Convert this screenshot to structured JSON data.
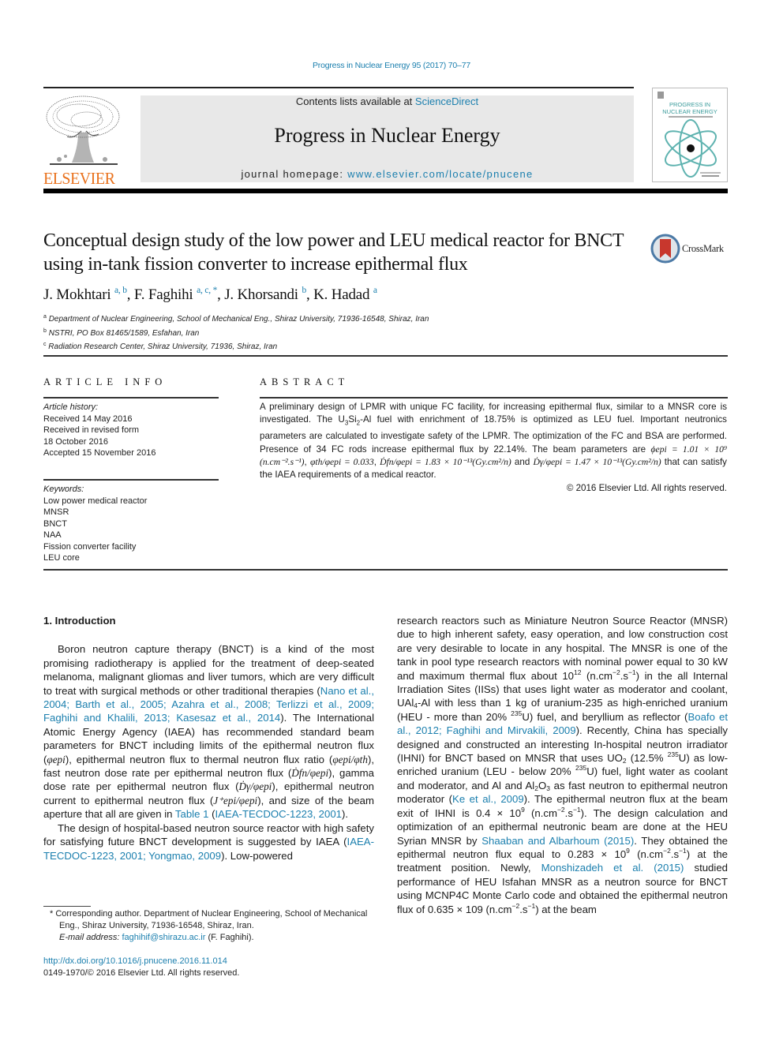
{
  "header": {
    "journal_ref": "Progress in Nuclear Energy 95 (2017) 70–77",
    "contents_prefix": "Contents lists available at ",
    "contents_link": "ScienceDirect",
    "journal_title": "Progress in Nuclear Energy",
    "homepage_prefix": "journal homepage: ",
    "homepage_link": "www.elsevier.com/locate/pnucene",
    "publisher_logo_text": "ELSEVIER",
    "cover_title_line1": "PROGRESS IN",
    "cover_title_line2": "NUCLEAR ENERGY",
    "crossmark_label": "CrossMark",
    "colors": {
      "link": "#1b7fae",
      "elsevier_orange": "#e9711c",
      "cover_teal": "#3a9b9b"
    }
  },
  "article": {
    "title": "Conceptual design study of the low power and LEU medical reactor for BNCT using in-tank fission converter to increase epithermal flux",
    "authors": [
      {
        "name": "J. Mokhtari",
        "sup": "a, b"
      },
      {
        "name": "F. Faghihi",
        "sup": "a, c, *"
      },
      {
        "name": "J. Khorsandi",
        "sup": "b"
      },
      {
        "name": "K. Hadad",
        "sup": "a"
      }
    ],
    "affiliations": [
      {
        "key": "a",
        "text": "Department of Nuclear Engineering, School of Mechanical Eng., Shiraz University, 71936-16548, Shiraz, Iran"
      },
      {
        "key": "b",
        "text": "NSTRI, PO Box 81465/1589, Esfahan, Iran"
      },
      {
        "key": "c",
        "text": "Radiation Research Center, Shiraz University, 71936, Shiraz, Iran"
      }
    ]
  },
  "article_info": {
    "heading": "ARTICLE INFO",
    "history_label": "Article history:",
    "history": [
      "Received 14 May 2016",
      "Received in revised form",
      "18 October 2016",
      "Accepted 15 November 2016"
    ],
    "keywords_label": "Keywords:",
    "keywords": [
      "Low power medical reactor",
      "MNSR",
      "BNCT",
      "NAA",
      "Fission converter facility",
      "LEU core"
    ]
  },
  "abstract": {
    "heading": "ABSTRACT",
    "p1": "A preliminary design of LPMR with unique FC facility, for increasing epithermal flux, similar to a MNSR core is investigated. The U",
    "p1b": "-Al fuel with enrichment of 18.75% is optimized as LEU fuel. Important neutronics parameters are calculated to investigate safety of the LPMR. The optimization of the FC and BSA are performed. Presence of 34 FC rods increase epithermal flux by 22.14%. The beam parameters are ",
    "m1": "ϕepi = 1.01 × 10⁹ (n.cm⁻².s⁻¹)",
    "sep1": ", ",
    "m2": "φth/φepi = 0.033",
    "sep2": ", ",
    "m3": "Ḋfn/φepi = 1.83 × 10⁻¹³(Gy.cm²/n)",
    "sep3": " and ",
    "m4": "Ḋγ/φepi = 1.47 × 10⁻¹³(Gy.cm²/n)",
    "tail": " that can satisfy the IAEA requirements of a medical reactor.",
    "copyright": "© 2016 Elsevier Ltd. All rights reserved."
  },
  "body": {
    "section_heading": "1.  Introduction",
    "left_p1": "Boron neutron capture therapy (BNCT) is a kind of the most promising radiotherapy is applied for the treatment of deep-seated melanoma, malignant gliomas and liver tumors, which are very difficult to treat with surgical methods or other traditional therapies (",
    "left_p1_refs": "Nano et al., 2004; Barth et al., 2005; Azahra et al., 2008; Terlizzi et al., 2009; Faghihi and Khalili, 2013; Kasesaz et al., 2014",
    "left_p1_b": "). The International Atomic Energy Agency (IAEA) has recommended standard beam parameters for BNCT including limits of the epithermal neutron flux (",
    "left_p1_c": "), epithermal neutron flux to thermal neutron flux ratio (",
    "left_p1_d": "), fast neutron dose rate per epithermal neutron flux (",
    "left_p1_e": "), gamma dose rate per epithermal neutron flux (",
    "left_p1_f": "), epithermal neutron current to epithermal neutron flux (",
    "left_p1_g": "), and size of the beam aperture that all are given in ",
    "left_p1_table": "Table 1",
    "left_p1_h": " (",
    "left_p1_ref2": "IAEA-TECDOC-1223, 2001",
    "left_p1_i": ").",
    "sym_epi": "φepi",
    "sym_ratio": "φepi/φth",
    "sym_dfn": "Ḋfn/φepi",
    "sym_dg": "Ḋγ/φepi",
    "sym_j": "J⁺epi/φepi",
    "left_p2": "The design of hospital-based neutron source reactor with high safety for satisfying future BNCT development is suggested by IAEA (",
    "left_p2_refs": "IAEA-TECDOC-1223, 2001; Yongmao, 2009",
    "left_p2_b": "). Low-powered",
    "right_a": "research reactors such as Miniature Neutron Source Reactor (MNSR) due to high inherent safety, easy operation, and low construction cost are very desirable to locate in any hospital. The MNSR is one of the tank in pool type research reactors with nominal power equal to 30 kW and maximum thermal flux about 10",
    "right_a_sup": "12",
    "right_b": " (n.cm",
    "right_c": ") in the all Internal Irradiation Sites (IISs) that uses light water as moderator and coolant, UAl",
    "right_d": "-Al with less than 1 kg of uranium-235 as high-enriched uranium (HEU - more than 20% ",
    "right_e": "U) fuel, and beryllium as reflector (",
    "right_refs1": "Boafo et al., 2012; Faghihi and Mirvakili, 2009",
    "right_f": "). Recently, China has specially designed and constructed an interesting In-hospital neutron irradiator (IHNI) for BNCT based on MNSR that uses UO",
    "right_g": " (12.5% ",
    "right_h": "U) as low-enriched uranium (LEU - below 20% ",
    "right_i": "U) fuel, light water as coolant and moderator, and Al and Al",
    "right_j": "O",
    "right_k": " as fast neutron to epithermal neutron moderator (",
    "right_refs2": "Ke et al., 2009",
    "right_l": "). The epithermal neutron flux at the beam exit of IHNI is 0.4 × 10",
    "right_m": " (n.cm",
    "right_n": "). The design calculation and optimization of an epithermal neutronic beam are done at the HEU Syrian MNSR by ",
    "right_refs3": "Shaaban and Albarhoum (2015)",
    "right_o": ". They obtained the epithermal neutron flux equal to 0.283 × 10",
    "right_p": " (n.cm",
    "right_q": ") at the treatment position. Newly, ",
    "right_refs4": "Monshizadeh et al. (2015)",
    "right_r": " studied performance of HEU Isfahan MNSR as a neutron source for BNCT using MCNP4C Monte Carlo code and obtained the epithermal neutron flux of 0.635 × 109 (n.cm",
    "right_s": ") at the beam",
    "exp9": "9",
    "exp_m2": "−2",
    "exp_m1": "−1",
    "dot_s": ".s",
    "iso235": "235",
    "sub2": "2",
    "sub3": "3",
    "sub4": "4"
  },
  "footer": {
    "corresponding": "* Corresponding author. Department of Nuclear Engineering, School of Mechanical Eng., Shiraz University, 71936-16548, Shiraz, Iran.",
    "email_label": "E-mail address: ",
    "email": "faghihif@shirazu.ac.ir",
    "email_suffix": " (F. Faghihi).",
    "doi": "http://dx.doi.org/10.1016/j.pnucene.2016.11.014",
    "issn": "0149-1970/© 2016 Elsevier Ltd. All rights reserved."
  }
}
